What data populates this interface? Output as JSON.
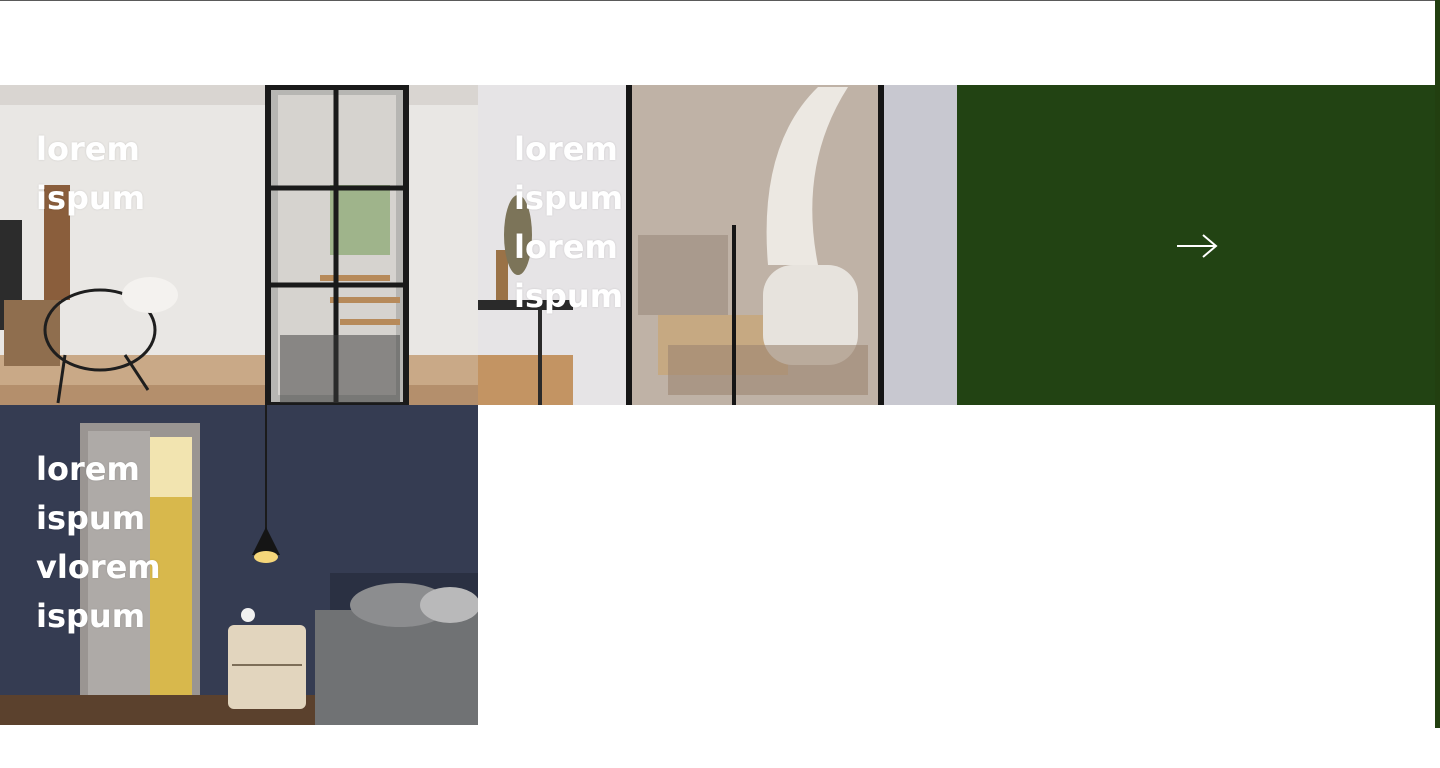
{
  "tiles": [
    {
      "lines": [
        "lorem",
        "ispum"
      ]
    },
    {
      "lines": [
        "lorem",
        "ispum",
        "lorem",
        "ispum"
      ]
    },
    {
      "lines": [
        "lorem",
        "ispum",
        "vlorem",
        "ispum"
      ]
    }
  ],
  "next_tile": {
    "icon": "arrow-right-icon",
    "color": "#224313"
  },
  "colors": {
    "accent": "#224313",
    "label_text": "#ffffff",
    "background": "#ffffff"
  }
}
